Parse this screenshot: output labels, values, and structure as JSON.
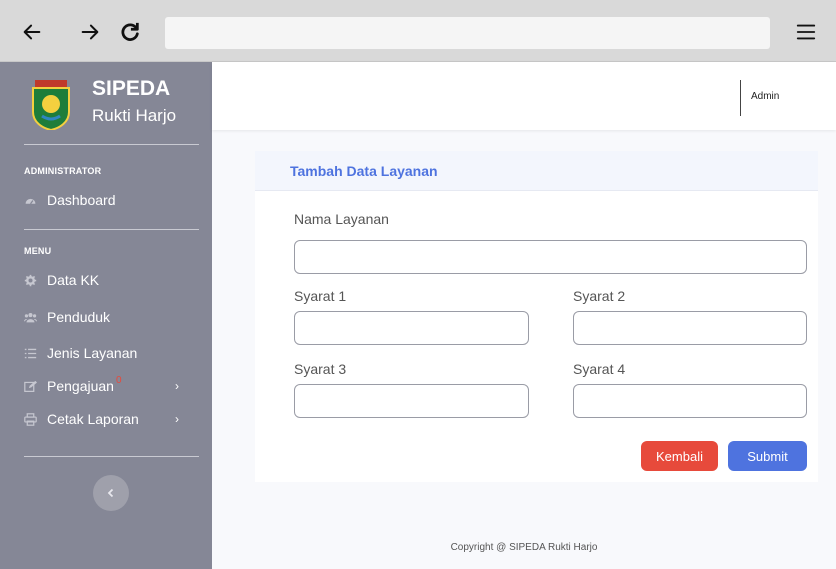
{
  "browser": {
    "back_icon": "arrow-left-icon",
    "forward_icon": "arrow-right-icon",
    "reload_icon": "reload-icon",
    "menu_icon": "hamburger-menu-icon",
    "url": ""
  },
  "sidebar": {
    "brand_title": "SIPEDA",
    "brand_subtitle": "Rukti Harjo",
    "section_admin": "ADMINISTRATOR",
    "section_menu": "MENU",
    "items": [
      {
        "label": "Dashboard",
        "icon": "tachometer-icon"
      },
      {
        "label": "Data KK",
        "icon": "gear-icon"
      },
      {
        "label": "Penduduk",
        "icon": "users-icon"
      },
      {
        "label": "Jenis Layanan",
        "icon": "list-icon"
      },
      {
        "label": "Pengajuan",
        "icon": "edit-icon",
        "badge": "0",
        "chevron": "›"
      },
      {
        "label": "Cetak Laporan",
        "icon": "print-icon",
        "chevron": "›"
      }
    ],
    "toggle_icon": "chevron-left-icon",
    "background_color": "#858796"
  },
  "topbar": {
    "user_name": "Admin"
  },
  "form": {
    "title": "Tambah Data Layanan",
    "nama_layanan_label": "Nama Layanan",
    "nama_layanan_value": "",
    "syarat1_label": "Syarat 1",
    "syarat1_value": "",
    "syarat2_label": "Syarat 2",
    "syarat2_value": "",
    "syarat3_label": "Syarat 3",
    "syarat3_value": "",
    "syarat4_label": "Syarat 4",
    "syarat4_value": "",
    "back_button": "Kembali",
    "submit_button": "Submit",
    "accent_color": "#4e73df",
    "danger_color": "#e74a3b"
  },
  "footer": {
    "copyright": "Copyright @ SIPEDA Rukti Harjo"
  }
}
